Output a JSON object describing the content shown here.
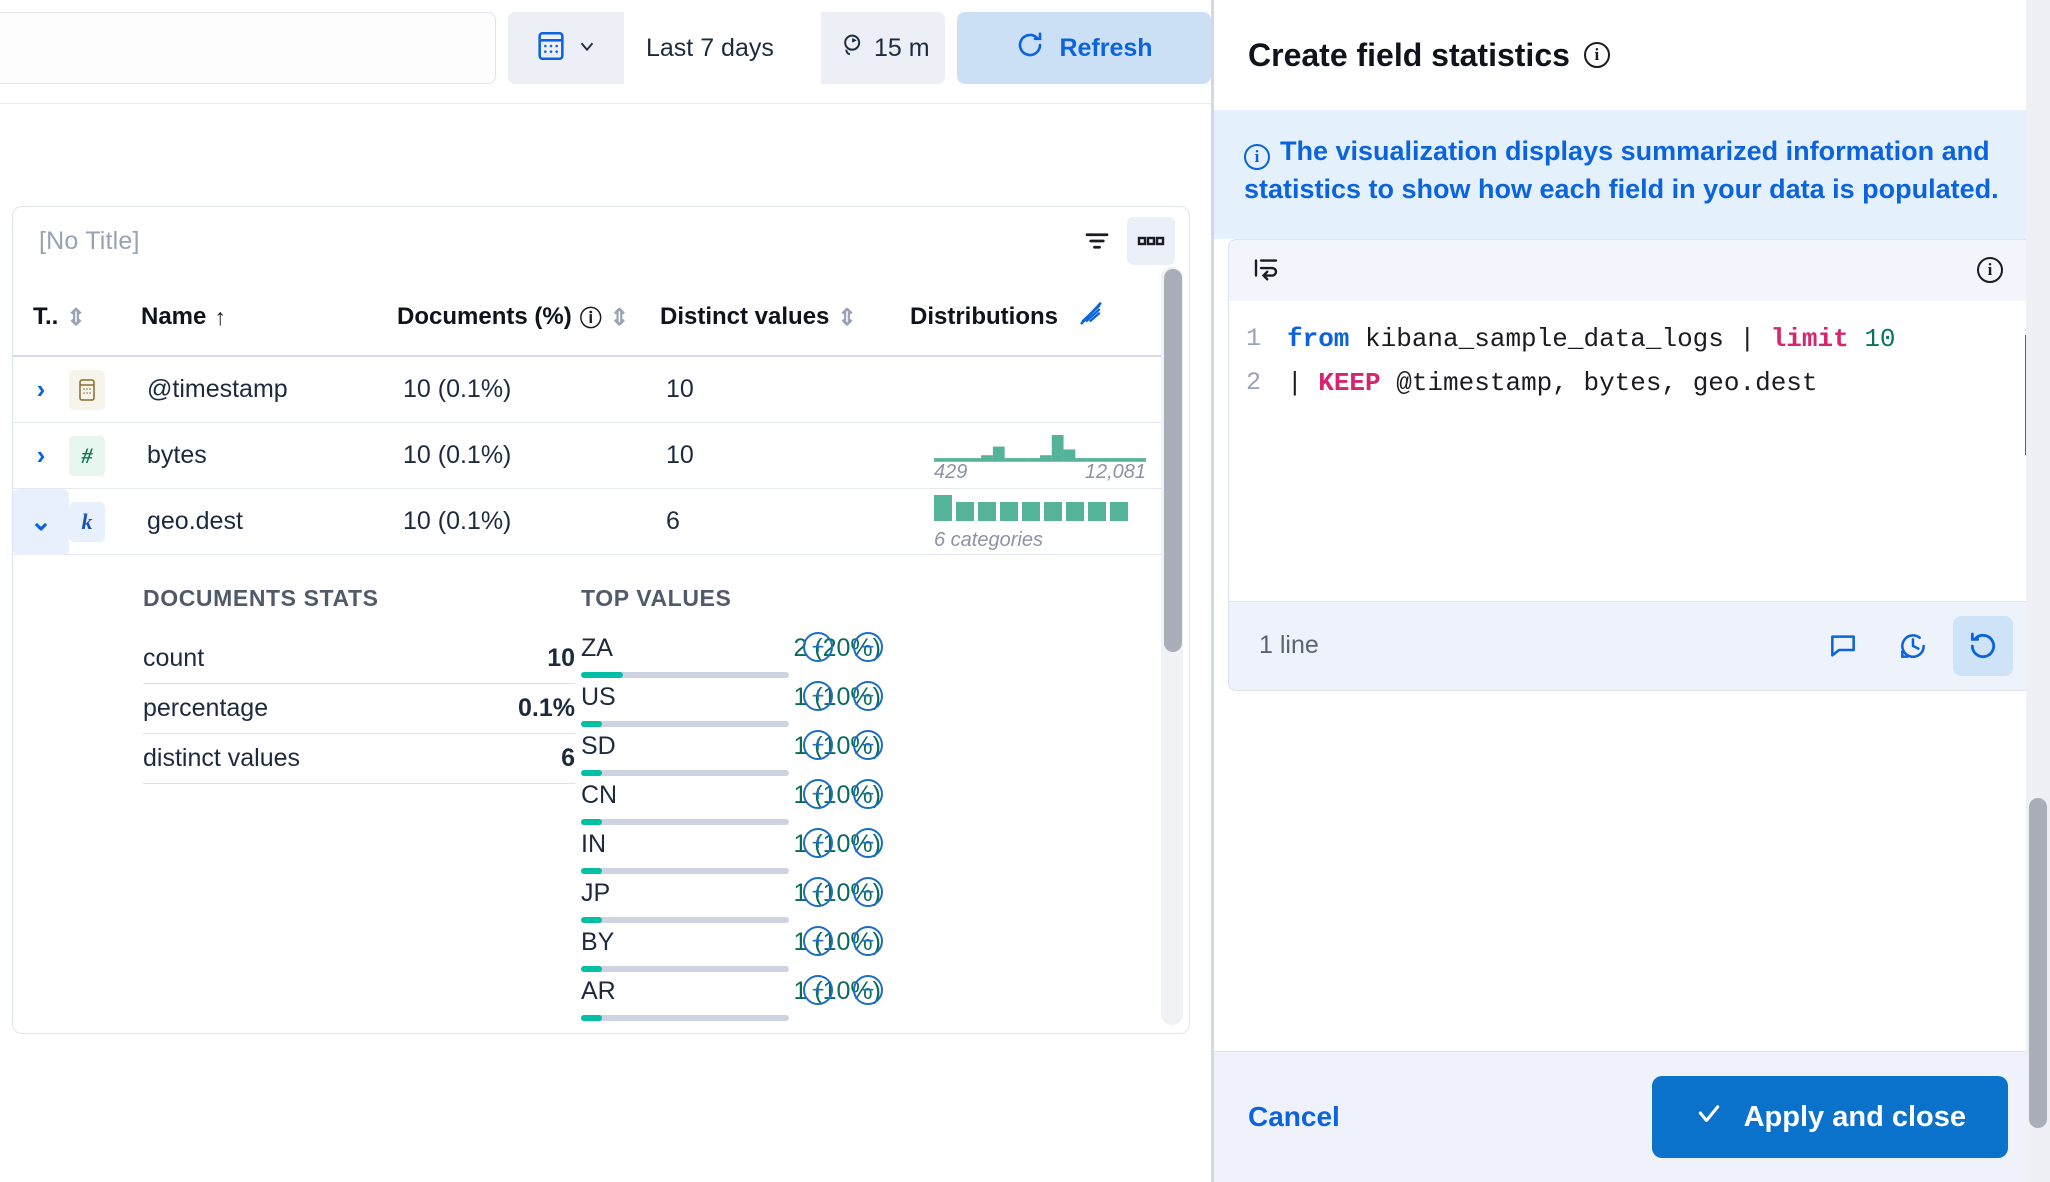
{
  "toolbar": {
    "query_placeholder": "",
    "calendar_icon": "calendar-icon",
    "chevron_icon": "chevron-down-icon",
    "time_range": "Last 7 days",
    "refresh_interval": "15 m",
    "refresh_interval_icon": "clock-refresh-icon",
    "refresh_label": "Refresh",
    "refresh_icon": "refresh-icon"
  },
  "field_stats_panel": {
    "title": "[No Title]",
    "filter_icon": "filter-icon",
    "context_menu_icon": "panel-actions-icon",
    "columns": [
      {
        "key": "type",
        "label": "T..",
        "sort": "sortable"
      },
      {
        "key": "name",
        "label": "Name",
        "sort": "asc"
      },
      {
        "key": "documents",
        "label": "Documents (%)",
        "help": "help-icon",
        "sort": "sortable"
      },
      {
        "key": "distinct",
        "label": "Distinct values",
        "sort": "sortable"
      },
      {
        "key": "distributions",
        "label": "Distributions",
        "toggle_icon": "hide-distributions-icon"
      }
    ],
    "rows": [
      {
        "expanded": false,
        "type_badge": "date",
        "type_letter": "▤",
        "name": "@timestamp",
        "documents": "10 (0.1%)",
        "distinct": "10",
        "distribution": {
          "kind": "none"
        }
      },
      {
        "expanded": false,
        "type_badge": "number",
        "type_letter": "#",
        "name": "bytes",
        "documents": "10 (0.1%)",
        "distinct": "10",
        "distribution": {
          "kind": "histogram",
          "min_label": "429",
          "max_label": "12,081",
          "bins": [
            1,
            1,
            1,
            1,
            2,
            5,
            1,
            1,
            1,
            2,
            9,
            4,
            1,
            1,
            1,
            1,
            1,
            1
          ]
        }
      },
      {
        "expanded": true,
        "type_badge": "keyword",
        "type_letter": "k",
        "name": "geo.dest",
        "documents": "10 (0.1%)",
        "distinct": "6",
        "distribution": {
          "kind": "categories",
          "caption": "6 categories",
          "bars": [
            20,
            14,
            14,
            14,
            14,
            14,
            14,
            14,
            14
          ]
        }
      }
    ],
    "detail": {
      "documents_stats_title": "DOCUMENTS STATS",
      "documents_stats": [
        {
          "label": "count",
          "value": "10"
        },
        {
          "label": "percentage",
          "value": "0.1%"
        },
        {
          "label": "distinct values",
          "value": "6"
        }
      ],
      "top_values_title": "TOP VALUES",
      "top_values": [
        {
          "key": "ZA",
          "count": "2 (20%)",
          "pct": 20
        },
        {
          "key": "US",
          "count": "1 (10%)",
          "pct": 10
        },
        {
          "key": "SD",
          "count": "1 (10%)",
          "pct": 10
        },
        {
          "key": "CN",
          "count": "1 (10%)",
          "pct": 10
        },
        {
          "key": "IN",
          "count": "1 (10%)",
          "pct": 10
        },
        {
          "key": "JP",
          "count": "1 (10%)",
          "pct": 10
        },
        {
          "key": "BY",
          "count": "1 (10%)",
          "pct": 10
        },
        {
          "key": "AR",
          "count": "1 (10%)",
          "pct": 10
        }
      ],
      "filter_for_icon": "filter-for-value-icon",
      "filter_out_icon": "filter-out-value-icon"
    }
  },
  "flyout": {
    "title": "Create field statistics",
    "title_info_icon": "info-icon",
    "callout_icon": "info-icon",
    "callout": "The visualization displays summarized information and statistics to show how each field in your data is populated.",
    "editor": {
      "wrap_lines_icon": "wrap-lines-icon",
      "help_icon": "info-icon",
      "lines": [
        {
          "number": "1",
          "tokens": [
            {
              "t": "from",
              "c": "cmd"
            },
            {
              "t": " kibana_sample_data_logs | ",
              "c": "plain"
            },
            {
              "t": "limit",
              "c": "pink"
            },
            {
              "t": " ",
              "c": "plain"
            },
            {
              "t": "10",
              "c": "num"
            }
          ]
        },
        {
          "number": "2",
          "tokens": [
            {
              "t": "| ",
              "c": "plain"
            },
            {
              "t": "KEEP",
              "c": "pink"
            },
            {
              "t": " @timestamp, bytes, geo.dest",
              "c": "plain"
            }
          ]
        }
      ],
      "line_count_label": "1 line",
      "feedback_icon": "comment-icon",
      "history_icon": "query-history-icon",
      "run_icon": "run-query-icon"
    },
    "cancel_label": "Cancel",
    "apply_label": "Apply and close",
    "apply_check_icon": "check-icon"
  },
  "colors": {
    "accent_blue": "#0B64DD",
    "primary_button": "#0B72CC",
    "callout_bg": "#E4F0FB",
    "teal_bar": "#00BFA5",
    "green_hist": "#54B399",
    "keyword_text": "#0B6B5B",
    "pink_keyword": "#D6246E"
  }
}
